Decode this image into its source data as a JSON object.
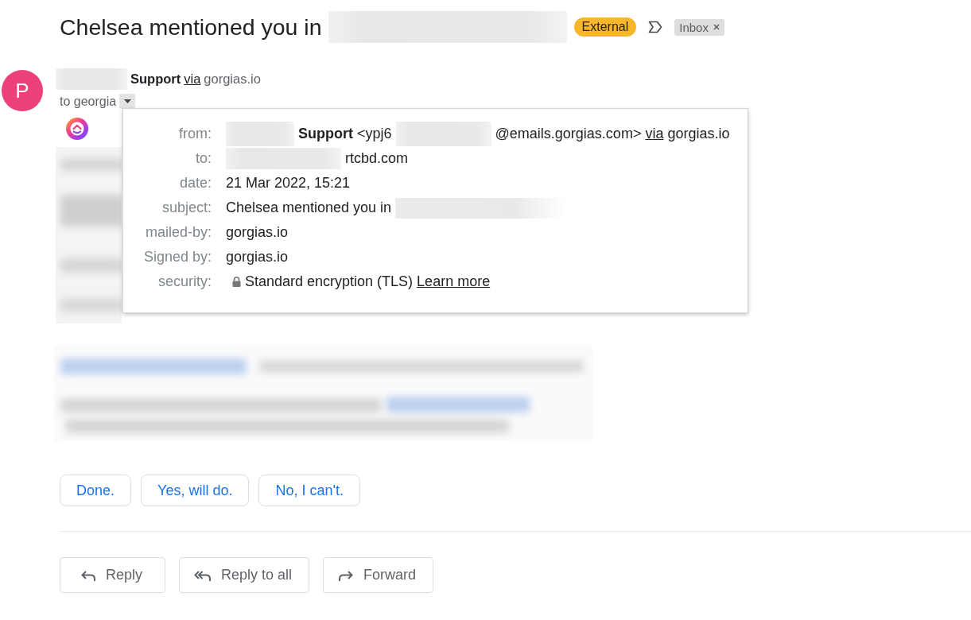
{
  "subject": {
    "parts": [
      {
        "kind": "text",
        "text": "Chelsea mentioned you in"
      },
      {
        "kind": "redacted"
      }
    ],
    "badge": "External",
    "important": false,
    "labels": [
      {
        "text": "Inbox",
        "removable": true
      }
    ]
  },
  "message": {
    "avatar_initial": "P",
    "sender": [
      {
        "kind": "redacted"
      },
      {
        "kind": "name",
        "text": "Support"
      },
      {
        "kind": "link",
        "text": "via"
      },
      {
        "kind": "text",
        "text": "gorgias.io"
      }
    ],
    "recipient": "to georgia",
    "details": {
      "open": true,
      "rows": [
        {
          "kind": "plain",
          "label": "from:",
          "parts": [
            {
              "kind": "redacted"
            },
            {
              "kind": "text",
              "text": "**Support** <ypj6"
            },
            {
              "kind": "redacted"
            },
            {
              "kind": "text",
              "text": "@emails.gorgias.com>"
            },
            {
              "kind": "link",
              "text": "via"
            },
            {
              "kind": "text",
              "text": "gorgias.io"
            }
          ]
        },
        {
          "kind": "plain",
          "label": "to:",
          "parts": [
            {
              "kind": "redacted"
            },
            {
              "kind": "text",
              "text": "rtcbd.com"
            }
          ]
        },
        {
          "kind": "plain",
          "label": "date:",
          "parts": [
            {
              "kind": "text",
              "text": "21 Mar 2022, 15:21"
            }
          ]
        },
        {
          "kind": "plain",
          "label": "subject:",
          "parts": [
            {
              "kind": "text",
              "text": "Chelsea mentioned you in"
            },
            {
              "kind": "redacted"
            }
          ]
        },
        {
          "kind": "plain",
          "label": "mailed-by:",
          "parts": [
            {
              "kind": "text",
              "text": "gorgias.io"
            }
          ]
        },
        {
          "kind": "plain",
          "label": "Signed by:",
          "parts": [
            {
              "kind": "text",
              "text": "gorgias.io"
            }
          ]
        },
        {
          "kind": "security",
          "label": "security:",
          "parts": [
            {
              "kind": "text",
              "text": "Standard encryption (TLS)"
            },
            {
              "kind": "link",
              "text": "Learn more"
            }
          ]
        }
      ]
    }
  },
  "smart_replies": [
    "Done.",
    "Yes, will do.",
    "No, I can't."
  ],
  "actions": [
    {
      "kind": "reply",
      "label": "Reply"
    },
    {
      "kind": "reply_all",
      "label": "Reply to all"
    },
    {
      "kind": "forward",
      "label": "Forward"
    }
  ]
}
